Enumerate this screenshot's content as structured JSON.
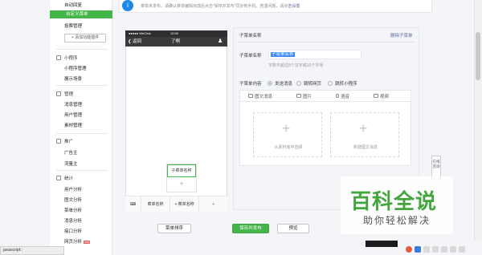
{
  "sidebar": {
    "items_top": [
      {
        "label": "自动回复"
      },
      {
        "label": "自定义菜单"
      },
      {
        "label": "投票管理"
      }
    ],
    "add_plugin": "+ 添加功能插件",
    "section_miniprogram": {
      "title": "小程序",
      "items": [
        "小程序管理",
        "展示场景"
      ]
    },
    "section_manage": {
      "title": "管理",
      "items": [
        "消息管理",
        "用户管理",
        "素材管理"
      ]
    },
    "section_promote": {
      "title": "推广",
      "items": [
        "广告主",
        "流量主"
      ]
    },
    "section_stats": {
      "title": "统计",
      "items": [
        "用户分析",
        "图文分析",
        "菜单分析",
        "消息分析",
        "接口分析",
        "网页分析"
      ]
    },
    "new_badge": "new"
  },
  "notice": {
    "text": "菜单未发布，请确认菜单编辑完成后点击“保存并发布”同步到手机。若遇问题，请点",
    "link": "击设置"
  },
  "phone": {
    "carrier": "●●●●● WeChat",
    "time": "12:00",
    "back": "返回",
    "title": "了啊",
    "menu_cells": [
      "菜单名称",
      "+ 菜单名称",
      "+"
    ],
    "sub_menu_item": "子菜单名称",
    "sub_add": "+"
  },
  "editor": {
    "header": "子菜单名称",
    "delete_link": "删除子菜单",
    "name_label": "子菜单名称",
    "name_value": "子菜单名称",
    "name_hint": "字数不超过8个汉字或16个字母",
    "content_label": "子菜单内容",
    "radios": [
      "发送消息",
      "跳转网页",
      "跳转小程序"
    ],
    "tabs": [
      "图文消息",
      "图片",
      "语音",
      "视频"
    ],
    "pick_library": "从素材库中选择",
    "pick_new": "新建图文消息"
  },
  "buttons": {
    "sort": "菜单排序",
    "save_publish": "保存并发布",
    "preview": "预览"
  },
  "online": "在线咨询",
  "watermark": {
    "big": "百科全说",
    "small": "助你轻松解决"
  },
  "statusbar": "javascript:;"
}
